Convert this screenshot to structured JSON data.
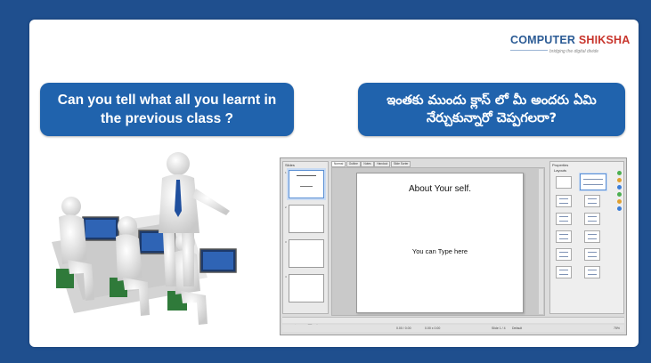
{
  "logo": {
    "part1": "COMPUTER",
    "part2": "SHIKSHA",
    "tagline": "bridging the digital divide"
  },
  "callouts": {
    "english": "Can you tell what all you learnt in the previous class ?",
    "telugu": "ఇంతకు ముందు క్లాస్ లో మీ అందరు ఏమి నేర్చుకున్నారో చెప్పగలరా?"
  },
  "screenshot": {
    "slides_pane_title": "Slides",
    "tabs": [
      "Normal",
      "Outline",
      "Notes",
      "Handout",
      "Slide Sorter"
    ],
    "slide_title": "About Your self.",
    "slide_body": "You can Type here",
    "thumb_numbers": [
      "1",
      "2",
      "3",
      "4"
    ],
    "properties_title": "Properties",
    "layouts_label": "Layouts",
    "status": {
      "position": "0.00 / 0.00",
      "size": "0.00 x 0.00",
      "slide": "Slide 1 / 4",
      "master": "Default",
      "zoom": "75%"
    }
  },
  "colors": {
    "background": "#1f4f8e",
    "callout": "#2063ad",
    "logo_blue": "#2b5b95",
    "logo_red": "#c8352c"
  }
}
